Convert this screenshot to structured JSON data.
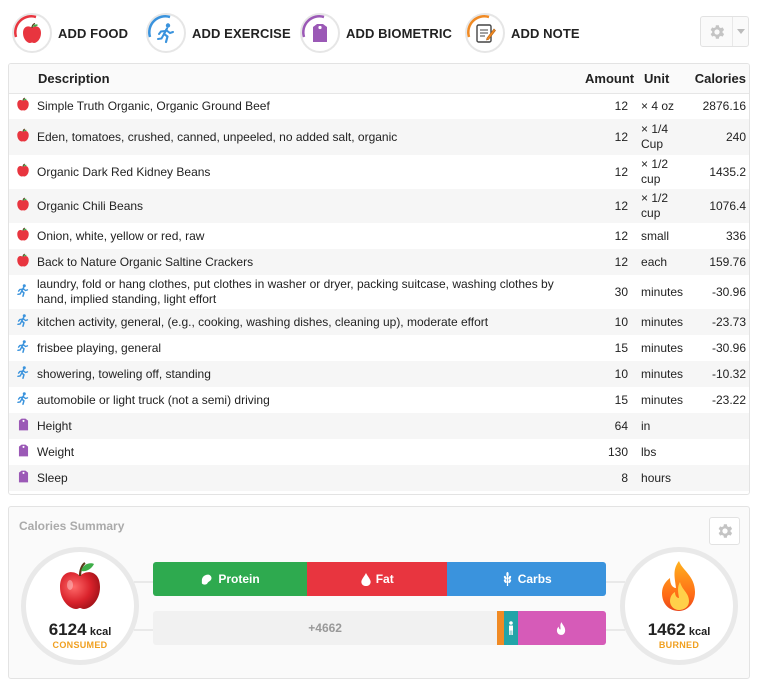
{
  "toolbar": {
    "add_food": "ADD FOOD",
    "add_exercise": "ADD EXERCISE",
    "add_biometric": "ADD BIOMETRIC",
    "add_note": "ADD NOTE"
  },
  "colors": {
    "food": "#e8353f",
    "exercise": "#3a93dd",
    "biometric": "#9b59b6",
    "note": "#f08a24",
    "protein": "#2eaa4f",
    "fat": "#e8353f",
    "carbs": "#3a93dd"
  },
  "table": {
    "headers": {
      "description": "Description",
      "amount": "Amount",
      "unit": "Unit",
      "calories": "Calories"
    },
    "rows": [
      {
        "type": "food",
        "icon": "apple-icon",
        "description": "Simple Truth Organic, Organic Ground Beef",
        "amount": "12",
        "unit": "× 4 oz",
        "calories": "2876.16"
      },
      {
        "type": "food",
        "icon": "apple-icon",
        "description": "Eden, tomatoes, crushed, canned, unpeeled, no added salt, organic",
        "amount": "12",
        "unit": "× 1/4 Cup",
        "calories": "240"
      },
      {
        "type": "food",
        "icon": "apple-icon",
        "description": "Organic Dark Red Kidney Beans",
        "amount": "12",
        "unit": "× 1/2 cup",
        "calories": "1435.2"
      },
      {
        "type": "food",
        "icon": "apple-icon",
        "description": "Organic Chili Beans",
        "amount": "12",
        "unit": "× 1/2 cup",
        "calories": "1076.4"
      },
      {
        "type": "food",
        "icon": "apple-icon",
        "description": "Onion, white, yellow or red, raw",
        "amount": "12",
        "unit": "small",
        "calories": "336"
      },
      {
        "type": "food",
        "icon": "apple-icon",
        "description": "Back to Nature Organic Saltine Crackers",
        "amount": "12",
        "unit": "each",
        "calories": "159.76"
      },
      {
        "type": "exercise",
        "icon": "runner-icon",
        "description": "laundry, fold or hang clothes, put clothes in washer or dryer, packing suitcase, washing clothes by hand, implied standing, light effort",
        "amount": "30",
        "unit": "minutes",
        "calories": "-30.96"
      },
      {
        "type": "exercise",
        "icon": "runner-icon",
        "description": "kitchen activity, general, (e.g., cooking, washing dishes, cleaning up), moderate effort",
        "amount": "10",
        "unit": "minutes",
        "calories": "-23.73"
      },
      {
        "type": "exercise",
        "icon": "runner-icon",
        "description": "frisbee playing, general",
        "amount": "15",
        "unit": "minutes",
        "calories": "-30.96"
      },
      {
        "type": "exercise",
        "icon": "runner-icon",
        "description": "showering, toweling off, standing",
        "amount": "10",
        "unit": "minutes",
        "calories": "-10.32"
      },
      {
        "type": "exercise",
        "icon": "runner-icon",
        "description": "automobile or light truck (not a semi) driving",
        "amount": "15",
        "unit": "minutes",
        "calories": "-23.22"
      },
      {
        "type": "biometric",
        "icon": "tag-icon",
        "description": "Height",
        "amount": "64",
        "unit": "in",
        "calories": ""
      },
      {
        "type": "biometric",
        "icon": "tag-icon",
        "description": "Weight",
        "amount": "130",
        "unit": "lbs",
        "calories": ""
      },
      {
        "type": "biometric",
        "icon": "tag-icon",
        "description": "Sleep",
        "amount": "8",
        "unit": "hours",
        "calories": ""
      }
    ]
  },
  "summary": {
    "title": "Calories Summary",
    "consumed_value": "6124",
    "consumed_unit": "kcal",
    "consumed_label": "CONSUMED",
    "burned_value": "1462",
    "burned_unit": "kcal",
    "burned_label": "BURNED",
    "macros": {
      "protein": "Protein",
      "fat": "Fat",
      "carbs": "Carbs",
      "protein_fraction": 0.34,
      "fat_fraction": 0.31,
      "carbs_fraction": 0.35
    },
    "net_label": "+4662",
    "remaining_fraction": 0.76,
    "orange_fraction": 0.015,
    "teal_fraction": 0.03,
    "burned_fraction": 0.195
  }
}
